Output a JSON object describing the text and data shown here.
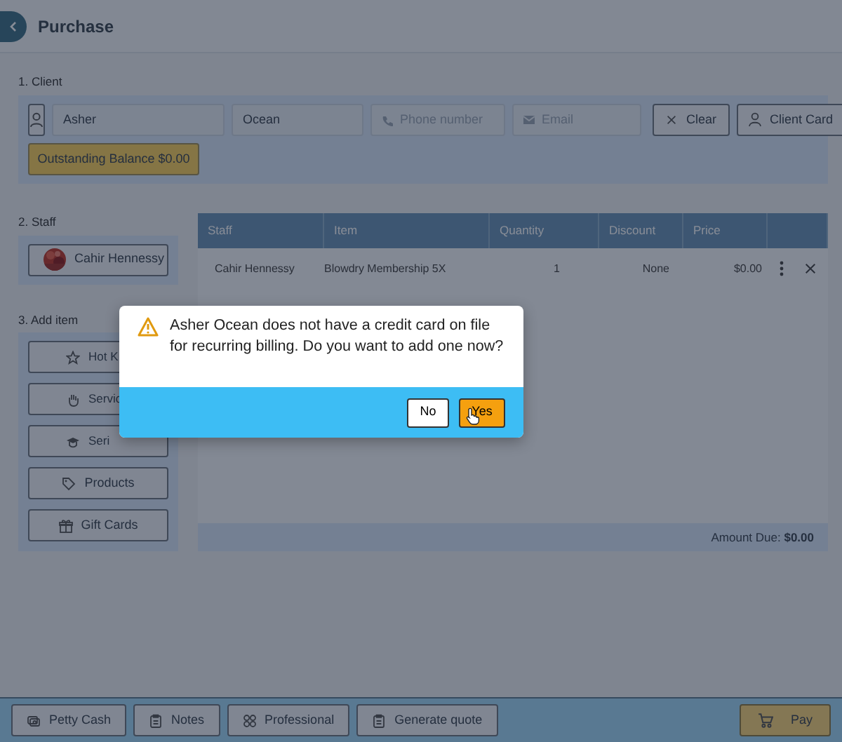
{
  "header": {
    "title": "Purchase"
  },
  "client": {
    "label": "1. Client",
    "first_name": "Asher",
    "last_name": "Ocean",
    "phone_placeholder": "Phone number",
    "email_placeholder": "Email",
    "clear_button": "Clear",
    "client_card_button": "Client Card",
    "balance_button": "Outstanding Balance $0.00"
  },
  "staff": {
    "label": "2. Staff",
    "staff_button": "Cahir Hennessy"
  },
  "add_item": {
    "label": "3. Add item",
    "buttons": [
      "Hot K",
      "Servic",
      "Seri",
      "Products",
      "Gift Cards"
    ]
  },
  "table": {
    "columns": [
      "Staff",
      "Item",
      "Quantity",
      "Discount",
      "Price"
    ],
    "rows": [
      {
        "staff": "Cahir Hennessy",
        "item": "Blowdry Membership 5X",
        "quantity": "1",
        "discount": "None",
        "price": "$0.00"
      }
    ],
    "amount_due": "Amount Due: **$0.00**"
  },
  "bottom_bar": {
    "buttons": [
      "Petty Cash",
      "Notes",
      "Professional",
      "Generate quote"
    ],
    "pay_button": "Pay"
  },
  "dialog": {
    "message": "Asher Ocean does not have a credit card on file for recurring billing. Do you want to add one now?",
    "buttons": [
      {
        "label": "No",
        "kind": "secondary"
      },
      {
        "label": "Yes",
        "kind": "primary"
      }
    ]
  }
}
